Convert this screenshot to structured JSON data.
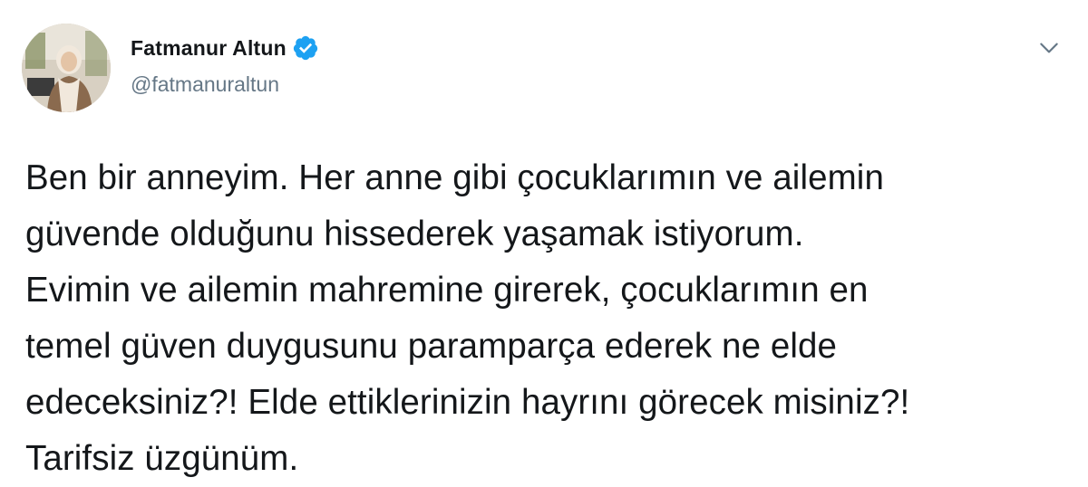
{
  "tweet": {
    "author": {
      "display_name": "Fatmanur Altun",
      "handle": "@fatmanuraltun",
      "verified": true,
      "avatar_icon": "profile-photo"
    },
    "menu_icon": "chevron-down-icon",
    "text": "Ben bir anneyim. Her anne gibi çocuklarımın ve ailemin\ngüvende olduğunu hissederek yaşamak istiyorum.\nEvimin ve ailemin mahremine girerek, çocuklarımın en\ntemel güven duygusunu paramparça ederek ne elde\nedeceksiniz?! Elde ettiklerinizin hayrını görecek misiniz?!\nTarifsiz üzgünüm."
  },
  "colors": {
    "text_primary": "#14171a",
    "text_secondary": "#657786",
    "verified_blue": "#1da1f2",
    "background": "#ffffff"
  }
}
